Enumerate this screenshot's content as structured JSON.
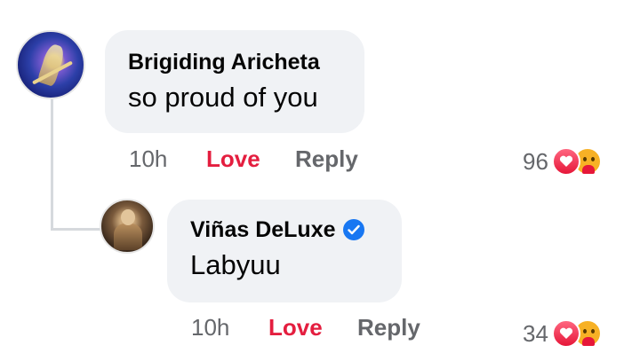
{
  "comments": [
    {
      "author": "Brigiding Aricheta",
      "text": "so proud of you",
      "time": "10h",
      "love_label": "Love",
      "reply_label": "Reply",
      "reaction_count": "96",
      "reactions": [
        "love-icon",
        "care-icon"
      ],
      "verified": false
    },
    {
      "author": "Viñas DeLuxe",
      "text": "Labyuu",
      "time": "10h",
      "love_label": "Love",
      "reply_label": "Reply",
      "reaction_count": "34",
      "reactions": [
        "love-icon",
        "care-icon"
      ],
      "verified": true
    }
  ],
  "colors": {
    "bubble": "#f0f2f5",
    "love": "#e41e3f",
    "meta": "#65676b",
    "verified": "#1877f2"
  }
}
